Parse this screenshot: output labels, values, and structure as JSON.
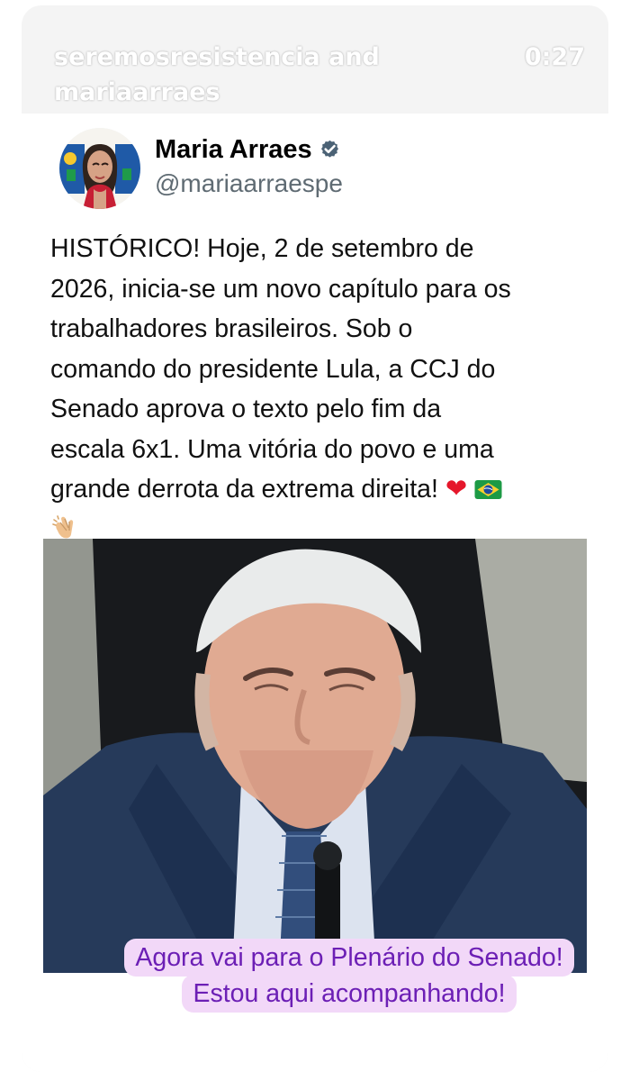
{
  "story": {
    "users": "seremosresistencia and mariaarraes",
    "time": "0:27"
  },
  "tweet": {
    "author_name": "Maria Arraes",
    "author_handle": "@mariaarraespe",
    "verified_icon": "verified-badge-icon",
    "text_lines": [
      "HISTÓRICO! Hoje, 2 de setembro de",
      "2026, inicia-se um novo capítulo para os",
      "trabalhadores brasileiros. Sob o",
      "comando do presidente Lula, a CCJ do",
      "Senado aprova o texto pelo fim da",
      "escala 6x1. Uma vitória do povo e uma",
      "grande derrota da extrema direita!"
    ],
    "emojis": [
      "heart-icon",
      "brazil-flag-icon",
      "clapping-hands-icon"
    ]
  },
  "caption": {
    "line_1": "Agora vai para o Plenário do Senado!",
    "line_2": "Estou aqui acompanhando!"
  },
  "colors": {
    "caption_text": "#6c1fb5",
    "caption_background": "#f2d8f8",
    "verified_blue": "#4b6275",
    "heart_red": "#e5172b"
  }
}
